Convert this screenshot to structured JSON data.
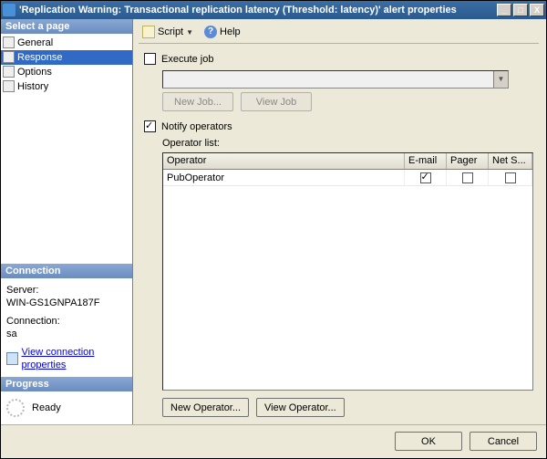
{
  "window": {
    "title": "'Replication Warning: Transactional replication latency (Threshold: latency)' alert properties"
  },
  "sidebar": {
    "select_page_header": "Select a page",
    "items": [
      {
        "label": "General"
      },
      {
        "label": "Response"
      },
      {
        "label": "Options"
      },
      {
        "label": "History"
      }
    ],
    "connection_header": "Connection",
    "server_label": "Server:",
    "server_value": "WIN-GS1GNPA187F",
    "connection_label": "Connection:",
    "connection_value": "sa",
    "view_conn_link": "View connection properties",
    "progress_header": "Progress",
    "progress_status": "Ready"
  },
  "toolbar": {
    "script_label": "Script",
    "help_label": "Help"
  },
  "form": {
    "execute_job_label": "Execute job",
    "execute_job_checked": false,
    "new_job_btn": "New Job...",
    "view_job_btn": "View Job",
    "notify_operators_label": "Notify operators",
    "notify_operators_checked": true,
    "operator_list_label": "Operator list:",
    "columns": {
      "operator": "Operator",
      "email": "E-mail",
      "pager": "Pager",
      "netsend": "Net S..."
    },
    "rows": [
      {
        "operator": "PubOperator",
        "email": true,
        "pager": false,
        "netsend": false
      }
    ],
    "new_operator_btn": "New Operator...",
    "view_operator_btn": "View Operator..."
  },
  "footer": {
    "ok": "OK",
    "cancel": "Cancel"
  }
}
